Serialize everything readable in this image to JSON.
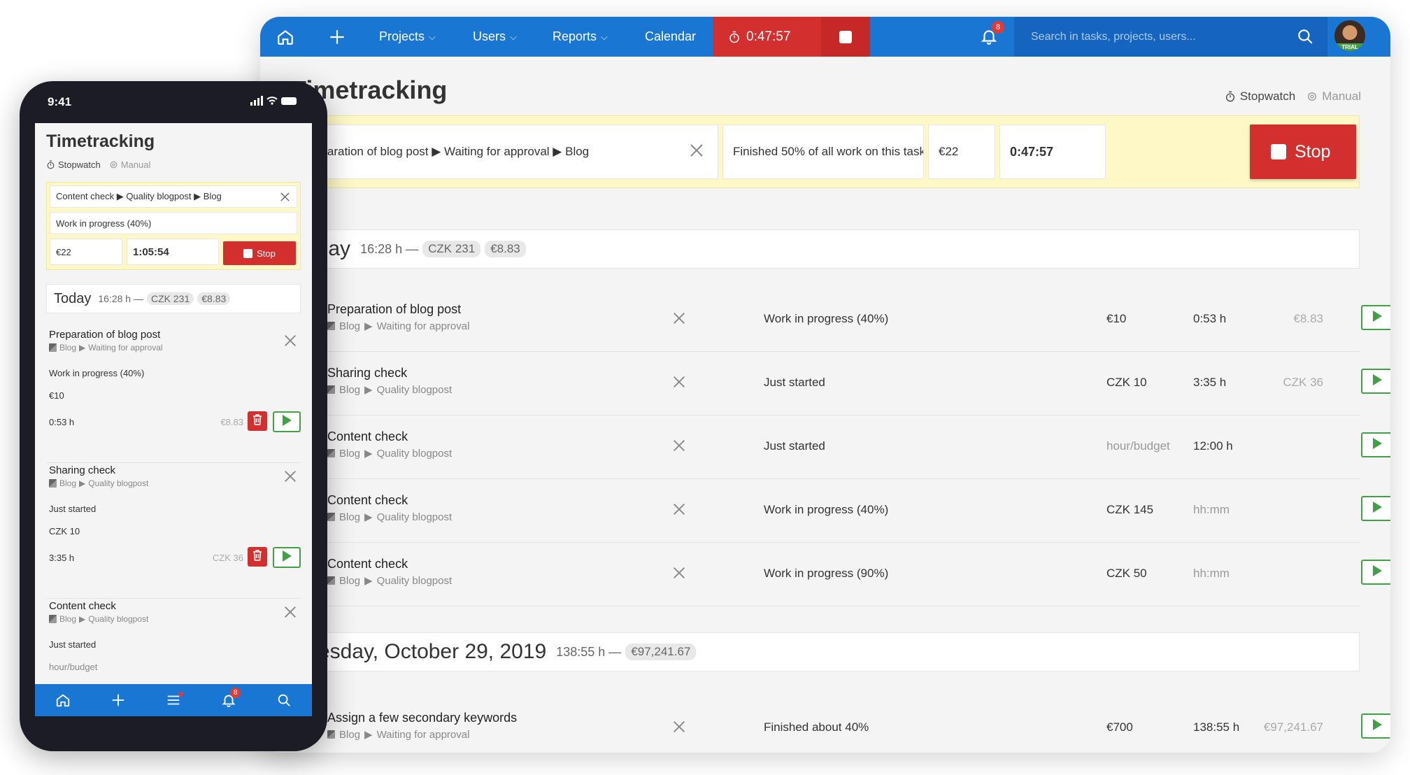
{
  "desktop": {
    "topbar": {
      "menus": [
        "Projects",
        "Users",
        "Reports",
        "Calendar"
      ],
      "timer": "0:47:57",
      "notifications_count": "8",
      "search_placeholder": "Search in tasks, projects, users...",
      "avatar_badge": "TRIAL"
    },
    "page_title": "Timetracking",
    "mode": {
      "stopwatch": "Stopwatch",
      "manual": "Manual"
    },
    "timer_bar": {
      "task_path": "Preparation of blog post ▶ Waiting for approval ▶ Blog",
      "note": "Finished 50% of all work on this task",
      "rate": "€22",
      "elapsed": "0:47:57",
      "stop_label": "Stop"
    },
    "today": {
      "title": "Today",
      "total_hours": "16:28 h —",
      "czk": "CZK 231",
      "eur": "€8.83",
      "entries": [
        {
          "task": "Preparation of blog post",
          "project": "Blog",
          "stage": "Waiting for approval",
          "status": "Work in progress (40%)",
          "rate": "€10",
          "time": "0:53 h",
          "cost": "€8.83"
        },
        {
          "task": "Sharing check",
          "project": "Blog",
          "stage": "Quality blogpost",
          "status": "Just started",
          "rate": "CZK 10",
          "time": "3:35 h",
          "cost": "CZK 36"
        },
        {
          "task": "Content check",
          "project": "Blog",
          "stage": "Quality blogpost",
          "status": "Just started",
          "rate": "hour/budget",
          "time": "12:00 h",
          "cost": ""
        },
        {
          "task": "Content check",
          "project": "Blog",
          "stage": "Quality blogpost",
          "status": "Work in progress (40%)",
          "rate": "CZK 145",
          "time": "hh:mm",
          "cost": ""
        },
        {
          "task": "Content check",
          "project": "Blog",
          "stage": "Quality blogpost",
          "status": "Work in progress (90%)",
          "rate": "CZK 50",
          "time": "hh:mm",
          "cost": ""
        }
      ]
    },
    "tuesday": {
      "title": "Tuesday, October 29, 2019",
      "total_hours": "138:55 h —",
      "eur": "€97,241.67",
      "entries": [
        {
          "task": "Assign a few secondary keywords",
          "project": "Blog",
          "stage": "Waiting for approval",
          "status": "Finished about 40%",
          "rate": "€700",
          "time": "138:55 h",
          "cost": "€97,241.67"
        }
      ]
    }
  },
  "phone": {
    "clock": "9:41",
    "title": "Timetracking",
    "mode": {
      "stopwatch": "Stopwatch",
      "manual": "Manual"
    },
    "timer": {
      "task_path": "Content check ▶ Quality blogpost ▶ Blog",
      "note": "Work in progress (40%)",
      "rate": "€22",
      "elapsed": "1:05:54",
      "stop_label": "Stop"
    },
    "today": {
      "title": "Today",
      "total_hours": "16:28 h —",
      "czk": "CZK 231",
      "eur": "€8.83"
    },
    "cards": [
      {
        "task": "Preparation of blog post",
        "project": "Blog",
        "stage": "Waiting for approval",
        "status": "Work in progress (40%)",
        "rate": "€10",
        "time": "0:53 h",
        "cost": "€8.83"
      },
      {
        "task": "Sharing check",
        "project": "Blog",
        "stage": "Quality blogpost",
        "status": "Just started",
        "rate": "CZK 10",
        "time": "3:35 h",
        "cost": "CZK 36"
      },
      {
        "task": "Content check",
        "project": "Blog",
        "stage": "Quality blogpost",
        "status": "Just started",
        "rate": "hour/budget"
      }
    ],
    "nav_badge": "8"
  },
  "colors": {
    "primary": "#1976d2",
    "danger": "#d32f2f",
    "success": "#43a047",
    "highlight": "#fdf8c6"
  }
}
